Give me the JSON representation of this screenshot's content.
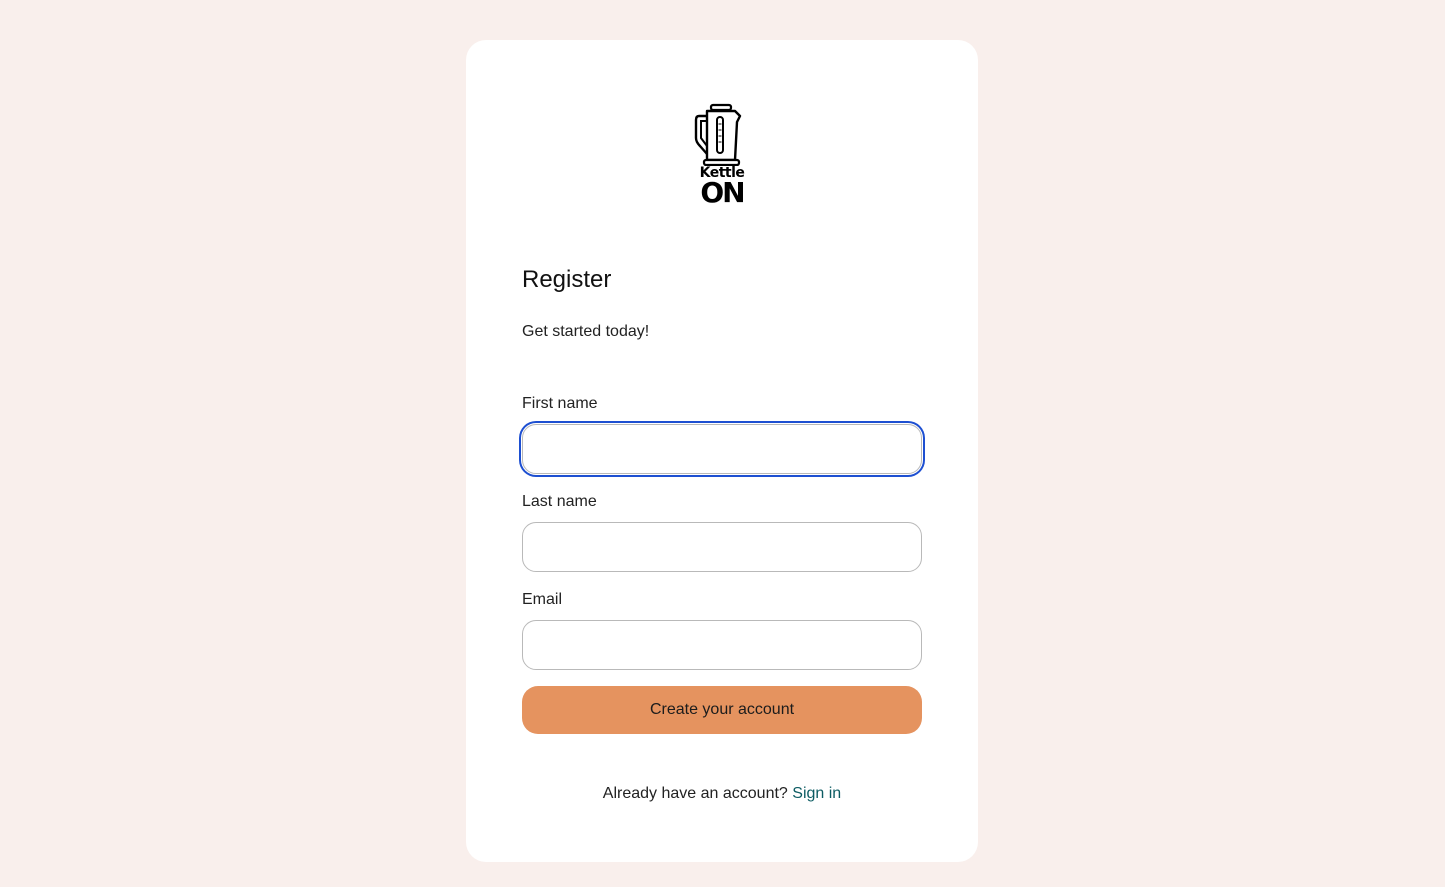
{
  "logo": {
    "icon": "kettle-icon",
    "word1": "Kettle",
    "word2": "ON"
  },
  "form": {
    "title": "Register",
    "subtitle": "Get started today!",
    "fields": [
      {
        "label": "First name",
        "value": "",
        "focused": true
      },
      {
        "label": "Last name",
        "value": ""
      },
      {
        "label": "Email",
        "value": ""
      }
    ],
    "submit_label": "Create your account"
  },
  "footer": {
    "prompt": "Already have an account?",
    "link_label": "Sign in"
  },
  "colors": {
    "background": "#f9efec",
    "card": "#ffffff",
    "button": "#e5935f",
    "link": "#0d5c63",
    "focus_ring": "#1d4fd1"
  }
}
